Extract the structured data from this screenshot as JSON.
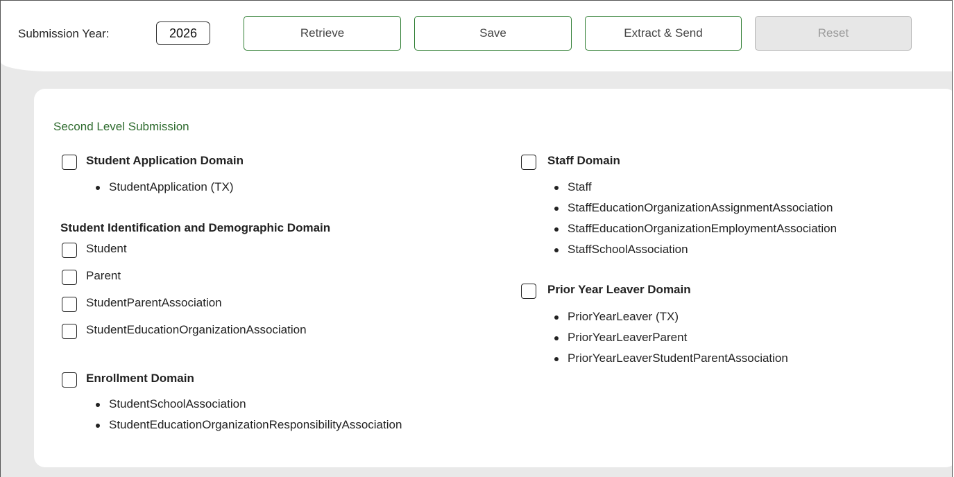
{
  "toolbar": {
    "submission_year_label": "Submission Year:",
    "submission_year_value": "2026",
    "retrieve_label": "Retrieve",
    "save_label": "Save",
    "extract_send_label": "Extract & Send",
    "reset_label": "Reset",
    "reset_disabled": true
  },
  "colors": {
    "accent_green": "#2e7d32",
    "section_title_green": "#2e6b2e",
    "background_gray": "#e9e9e9",
    "disabled_button": "#e7e7e7"
  },
  "panel": {
    "title": "Second Level Submission",
    "student_application": {
      "label": "Student Application Domain",
      "checked": false,
      "items": [
        "StudentApplication (TX)"
      ]
    },
    "student_identification": {
      "label": "Student Identification and Demographic Domain",
      "options": [
        {
          "label": "Student",
          "checked": false
        },
        {
          "label": "Parent",
          "checked": false
        },
        {
          "label": "StudentParentAssociation",
          "checked": false
        },
        {
          "label": "StudentEducationOrganizationAssociation",
          "checked": false
        }
      ]
    },
    "enrollment": {
      "label": "Enrollment Domain",
      "checked": false,
      "items": [
        "StudentSchoolAssociation",
        "StudentEducationOrganizationResponsibilityAssociation"
      ]
    },
    "staff": {
      "label": "Staff Domain",
      "checked": false,
      "items": [
        "Staff",
        "StaffEducationOrganizationAssignmentAssociation",
        "StaffEducationOrganizationEmploymentAssociation",
        "StaffSchoolAssociation"
      ]
    },
    "prior_year_leaver": {
      "label": "Prior Year Leaver Domain",
      "checked": false,
      "items": [
        "PriorYearLeaver (TX)",
        "PriorYearLeaverParent",
        "PriorYearLeaverStudentParentAssociation"
      ]
    }
  }
}
